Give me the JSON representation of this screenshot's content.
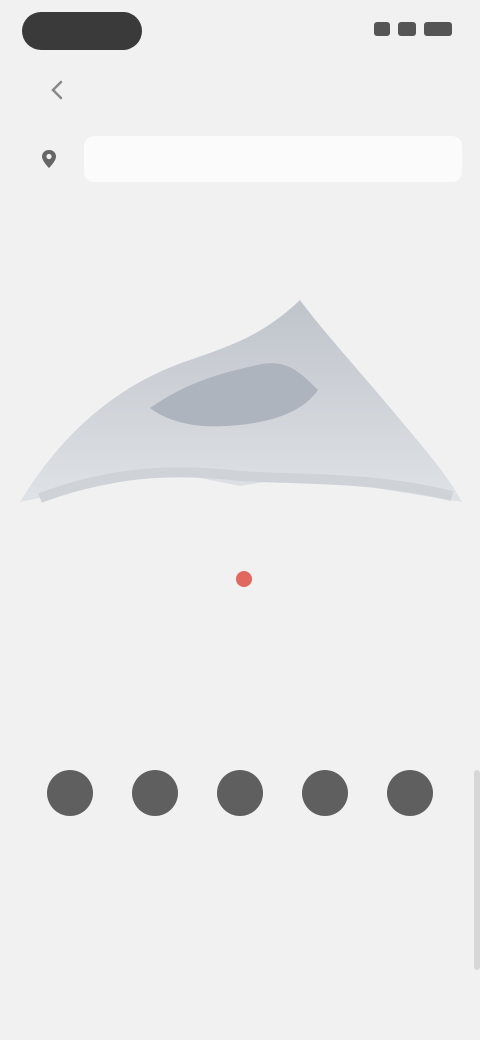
{
  "status_bar": {
    "time": "",
    "icons": [
      "signal-icon",
      "wifi-icon",
      "battery-icon"
    ]
  },
  "nav": {
    "title": "",
    "back_icon": "chevron-left-icon"
  },
  "search": {
    "chip_label": "",
    "placeholder": "",
    "chip_icon": "location-pin-icon"
  },
  "hero": {
    "label": "",
    "badge": "",
    "image": "mountain-landscape"
  },
  "rating": {
    "text": "",
    "accent_color": "#e0685e"
  },
  "description": "",
  "actions": {
    "caption": "",
    "items": [
      {
        "label": "",
        "icon": "circle-icon"
      },
      {
        "label": "",
        "icon": "circle-icon"
      },
      {
        "label": "",
        "icon": "circle-icon"
      },
      {
        "label": "",
        "icon": "circle-icon"
      },
      {
        "label": "",
        "icon": "circle-icon"
      }
    ]
  },
  "footer": {
    "title": "",
    "subtitle": ""
  },
  "colors": {
    "background": "#f1f1f2",
    "icon_fill": "#5f5f5f",
    "hero_fill": "#c8ccd2"
  }
}
